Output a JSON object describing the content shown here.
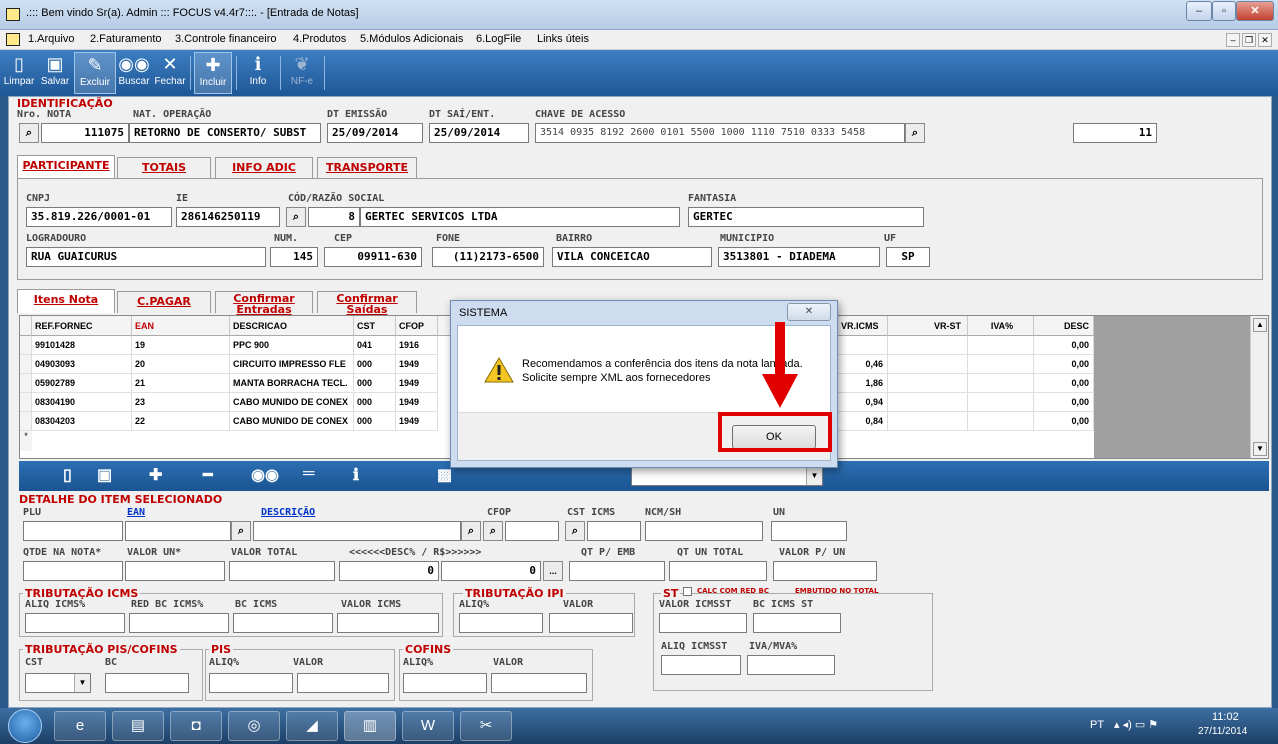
{
  "window": {
    "title": ".::: Bem vindo Sr(a). Admin ::: FOCUS v4.4r7:::.  - [Entrada de Notas]"
  },
  "menu": [
    "1.Arquivo",
    "2.Faturamento",
    "3.Controle financeiro",
    "4.Produtos",
    "5.Módulos Adicionais",
    "6.LogFile",
    "Links úteis"
  ],
  "toolbar": {
    "limpar": "Limpar",
    "salvar": "Salvar",
    "excluir": "Excluir",
    "buscar": "Buscar",
    "fechar": "Fechar",
    "incluir": "Incluir",
    "info": "Info",
    "nfe": "NF-e"
  },
  "identificacao": {
    "title": "IDENTIFICAÇÃO",
    "nro_label": "Nro. NOTA",
    "nro": "111075",
    "natop_label": "NAT. OPERAÇÃO",
    "natop": "RETORNO DE CONSERTO/ SUBST",
    "dtemis_label": "DT EMISSÃO",
    "dtemis": "25/09/2014",
    "dtsai_label": "DT SAÍ/ENT.",
    "dtsai": "25/09/2014",
    "chave_label": "CHAVE DE ACESSO",
    "chave": "3514 0935 8192 2600 0101 5500 1000 1110 7510 0333 5458",
    "count": "11"
  },
  "tabs_top": [
    "PARTICIPANTE",
    "TOTAIS",
    "INFO ADIC",
    "TRANSPORTE"
  ],
  "participante": {
    "cnpj_label": "CNPJ",
    "cnpj": "35.819.226/0001-01",
    "ie_label": "IE",
    "ie": "286146250119",
    "cod_label": "CÓD/RAZÃO SOCIAL",
    "cod": "8",
    "razao": "GERTEC SERVICOS LTDA",
    "fantasia_label": "FANTASIA",
    "fantasia": "GERTEC",
    "logradouro_label": "LOGRADOURO",
    "logradouro": "RUA GUAICURUS",
    "num_label": "NUM.",
    "num": "145",
    "cep_label": "CEP",
    "cep": "09911-630",
    "fone_label": "FONE",
    "fone": "(11)2173-6500",
    "bairro_label": "BAIRRO",
    "bairro": "VILA CONCEICAO",
    "municipio_label": "MUNICIPIO",
    "municipio": "3513801 - DIADEMA",
    "uf_label": "UF",
    "uf": "SP"
  },
  "tabs_items": {
    "itens": "Itens Nota",
    "cpagar": "C.PAGAR",
    "conf_ent_1": "Confirmar",
    "conf_ent_2": "Entradas",
    "conf_sai_1": "Confirmar",
    "conf_sai_2": "Saídas"
  },
  "grid": {
    "headers": {
      "ref": "REF.FORNEC",
      "ean": "EAN",
      "desc": "DESCRICAO",
      "cst": "CST",
      "cfop": "CFOP",
      "vricms": "VR.ICMS",
      "vrst": "VR-ST",
      "iva": "IVA%",
      "descp": "DESC"
    },
    "rows": [
      {
        "ref": "99101428",
        "ean": "19",
        "desc": "PPC 900",
        "cst": "041",
        "cfop": "1916",
        "vricms": "",
        "descp": "0,00"
      },
      {
        "ref": "04903093",
        "ean": "20",
        "desc": "CIRCUITO IMPRESSO FLE",
        "cst": "000",
        "cfop": "1949",
        "vricms": "0,46",
        "descp": "0,00"
      },
      {
        "ref": "05902789",
        "ean": "21",
        "desc": "MANTA BORRACHA TECL.",
        "cst": "000",
        "cfop": "1949",
        "vricms": "1,86",
        "descp": "0,00"
      },
      {
        "ref": "08304190",
        "ean": "23",
        "desc": "CABO MUNIDO DE CONEX",
        "cst": "000",
        "cfop": "1949",
        "vricms": "0,94",
        "descp": "0,00"
      },
      {
        "ref": "08304203",
        "ean": "22",
        "desc": "CABO MUNIDO DE CONEX",
        "cst": "000",
        "cfop": "1949",
        "vricms": "0,84",
        "descp": "0,00"
      }
    ]
  },
  "detalhe": {
    "title": "DETALHE DO ITEM SELECIONADO",
    "plu": "PLU",
    "ean": "EAN",
    "descricao": "DESCRIÇÃO",
    "cfop": "CFOP",
    "csticms": "CST ICMS",
    "ncm": "NCM/SH",
    "un": "UN",
    "qtde": "QTDE NA NOTA*",
    "valorun": "VALOR UN*",
    "valortotal": "VALOR TOTAL",
    "descpct": "<<<<<<DESC% / R$>>>>>>",
    "qtpemb": "QT P/ EMB",
    "qtuntotal": "QT UN TOTAL",
    "valorpun": "VALOR P/ UN",
    "desc_val1": "0",
    "desc_val2": "0",
    "ellipsis": "..."
  },
  "trib_icms": {
    "title": "TRIBUTAÇÃO ICMS",
    "aliq": "ALIQ ICMS%",
    "redbc": "RED BC ICMS%",
    "bc": "BC ICMS",
    "valor": "VALOR ICMS"
  },
  "trib_ipi": {
    "title": "TRIBUTAÇÃO IPI",
    "aliq": "ALIQ%",
    "valor": "VALOR"
  },
  "st": {
    "title": "ST",
    "calc": "CALC COM RED BC",
    "embutido": "EMBUTIDO NO TOTAL",
    "valoricmsst": "VALOR ICMSST",
    "bcicmsst": "BC ICMS ST",
    "aliqicmsst": "ALIQ ICMSST",
    "ivamva": "IVA/MVA%"
  },
  "pis_cofins": {
    "title": "TRIBUTAÇÃO PIS/COFINS",
    "cst": "CST",
    "bc": "BC",
    "pis": "PIS",
    "pis_aliq": "ALIQ%",
    "pis_valor": "VALOR",
    "cofins": "COFINS",
    "cofins_aliq": "ALIQ%",
    "cofins_valor": "VALOR"
  },
  "dialog": {
    "title": "SISTEMA",
    "line1": "Recomendamos a conferência dos itens da nota lançada.",
    "line2": "Solicite sempre XML aos fornecedores",
    "ok": "OK"
  },
  "taskbar": {
    "lang": "PT",
    "time": "11:02",
    "date": "27/11/2014"
  },
  "colors": {
    "toolbar": "#1f5796",
    "label_red": "#c00000",
    "highlight": "#e00000"
  }
}
